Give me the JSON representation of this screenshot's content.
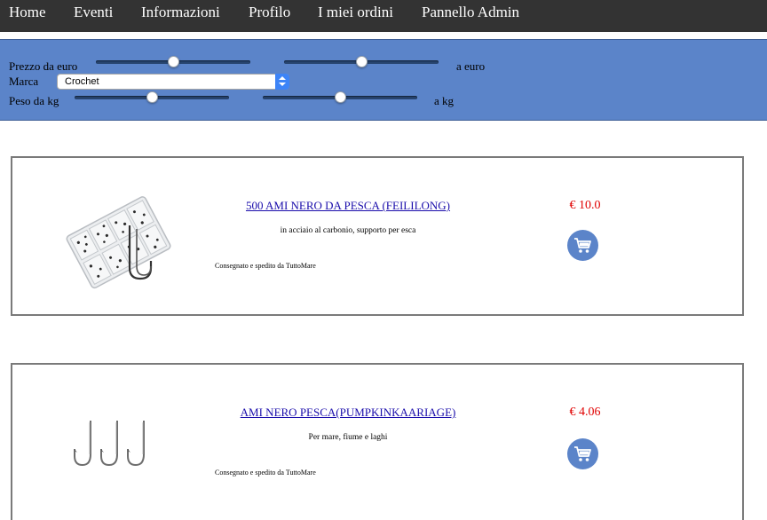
{
  "nav": {
    "items": [
      {
        "label": "Home"
      },
      {
        "label": "Eventi"
      },
      {
        "label": "Informazioni"
      },
      {
        "label": "Profilo"
      },
      {
        "label": "I miei ordini"
      },
      {
        "label": "Pannello Admin"
      }
    ]
  },
  "filters": {
    "price_from_label": "Prezzo da euro",
    "price_to_label": "a euro",
    "price_min_fraction": 0.5,
    "price_max_fraction": 0.5,
    "brand_label": "Marca",
    "brand_selected": "Crochet",
    "weight_from_label": "Peso da kg",
    "weight_to_label": "a kg",
    "weight_min_fraction": 0.5,
    "weight_max_fraction": 0.5
  },
  "products": [
    {
      "title": "500 AMI NERO DA PESCA (FEILILONG)",
      "description": "in acciaio al carbonio, supporto per esca",
      "seller": "Consegnato e spedito da TuttoMare",
      "price": "€ 10.0"
    },
    {
      "title": "AMI NERO PESCA(PUMPKINKAARIAGE)",
      "description": "Per mare, fiume e laghi",
      "seller": "Consegnato e spedito da TuttoMare",
      "price": "€ 4.06"
    }
  ],
  "colors": {
    "navbar": "#333333",
    "filter_panel": "#5b84c9",
    "price": "#e00000",
    "link": "#1a0dab",
    "cart_button": "#5b84c9"
  },
  "icons": {
    "cart": "shopping-cart-icon",
    "select": "chevron-updown-icon"
  }
}
